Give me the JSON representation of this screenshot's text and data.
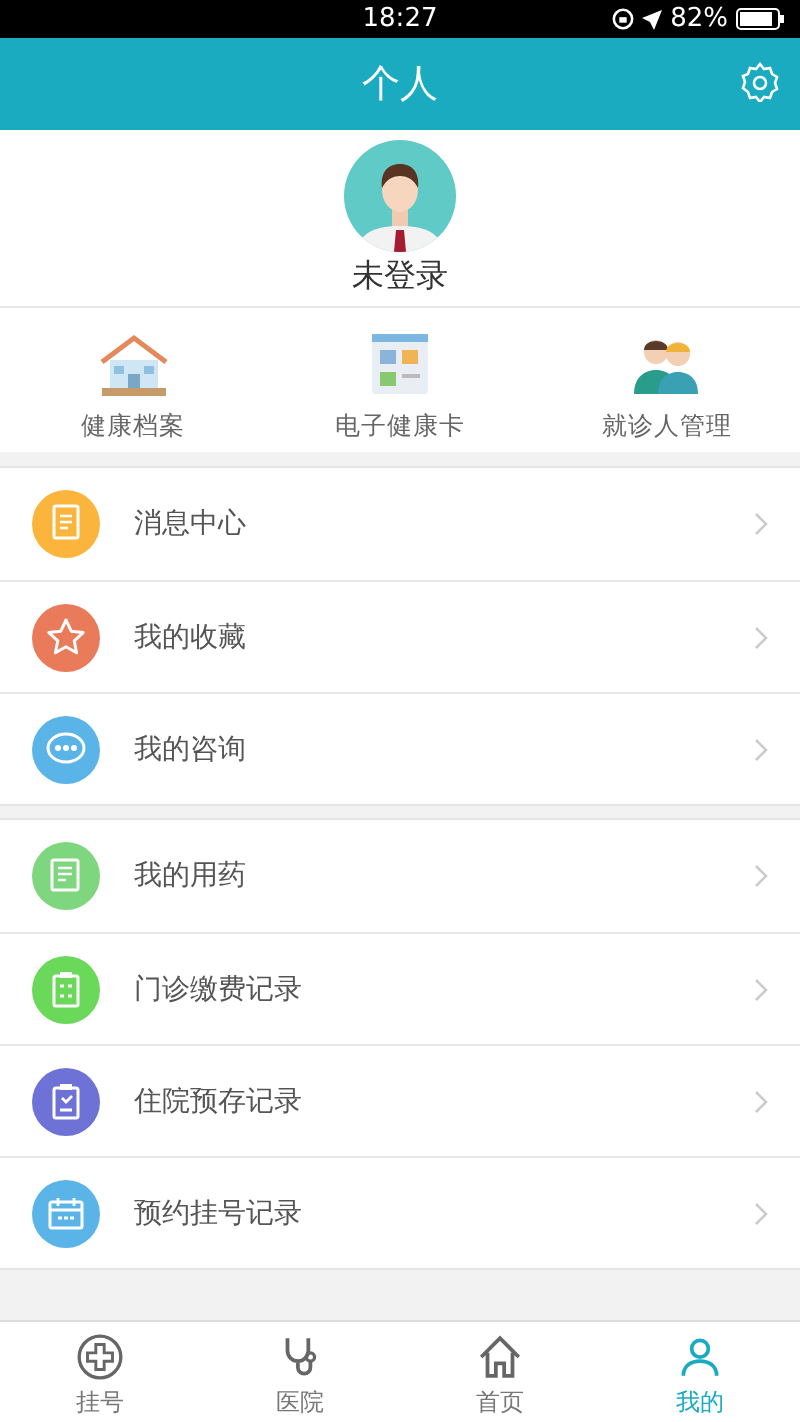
{
  "status_bar": {
    "time": "18:27",
    "battery": "82%"
  },
  "header": {
    "title": "个人"
  },
  "profile": {
    "name": "未登录"
  },
  "shortcuts": [
    {
      "label": "健康档案",
      "kind": "house"
    },
    {
      "label": "电子健康卡",
      "kind": "card"
    },
    {
      "label": "就诊人管理",
      "kind": "people"
    }
  ],
  "menu_groups": [
    [
      {
        "label": "消息中心",
        "kind": "doc",
        "color": "#fbb53c"
      },
      {
        "label": "我的收藏",
        "kind": "star",
        "color": "#ea7b5a"
      },
      {
        "label": "我的咨询",
        "kind": "chat",
        "color": "#5ab4e8"
      }
    ],
    [
      {
        "label": "我的用药",
        "kind": "note",
        "color": "#7ed67e"
      },
      {
        "label": "门诊缴费记录",
        "kind": "clip",
        "color": "#6ad858"
      },
      {
        "label": "住院预存记录",
        "kind": "clip2",
        "color": "#6e72d6"
      },
      {
        "label": "预约挂号记录",
        "kind": "cal",
        "color": "#5ab4e8"
      }
    ]
  ],
  "tab_bar": [
    {
      "label": "挂号",
      "kind": "plus",
      "selected": false
    },
    {
      "label": "医院",
      "kind": "steth",
      "selected": false
    },
    {
      "label": "首页",
      "kind": "home",
      "selected": false
    },
    {
      "label": "我的",
      "kind": "person",
      "selected": true
    }
  ]
}
